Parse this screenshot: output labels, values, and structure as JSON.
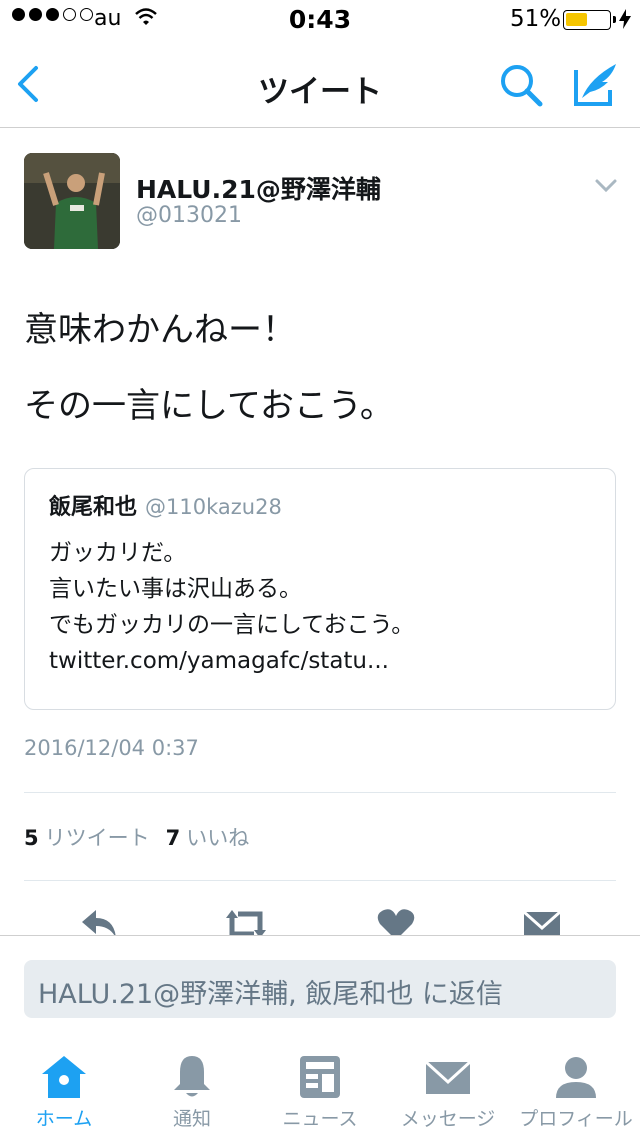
{
  "status_bar": {
    "carrier": "au",
    "time": "0:43",
    "battery_percent": "51%",
    "battery_level": 0.51,
    "signal_bars": 3,
    "signal_total": 5
  },
  "nav": {
    "title": "ツイート",
    "back_icon": "chevron-left-icon",
    "search_icon": "search-icon",
    "compose_icon": "compose-tweet-icon",
    "accent_color": "#1da1f2"
  },
  "tweet": {
    "user_name": "HALU.21@野澤洋輔",
    "user_handle": "@013021",
    "text_lines": [
      "意味わかんねー！",
      "その一言にしておこう。"
    ],
    "timestamp": "2016/12/04 0:37",
    "retweet_count": "5",
    "retweet_label": "リツイート",
    "like_count": "7",
    "like_label": "いいね"
  },
  "quoted_tweet": {
    "user_name": "飯尾和也",
    "user_handle": "@110kazu28",
    "lines": [
      "ガッカリだ。",
      "言いたい事は沢山ある。",
      "でもガッカリの一言にしておこう。",
      "twitter.com/yamagafc/statu..."
    ]
  },
  "actions": [
    "reply-icon",
    "retweet-icon",
    "like-icon",
    "message-icon"
  ],
  "reply": {
    "placeholder": "HALU.21@野澤洋輔, 飯尾和也 に返信"
  },
  "tab_bar": {
    "tabs": [
      {
        "label": "ホーム",
        "icon": "home-icon",
        "active": true
      },
      {
        "label": "通知",
        "icon": "bell-icon",
        "active": false
      },
      {
        "label": "ニュース",
        "icon": "news-icon",
        "active": false
      },
      {
        "label": "メッセージ",
        "icon": "envelope-icon",
        "active": false
      },
      {
        "label": "プロフィール",
        "icon": "person-icon",
        "active": false
      }
    ],
    "active_color": "#1da1f2",
    "inactive_color": "#8899a6"
  }
}
